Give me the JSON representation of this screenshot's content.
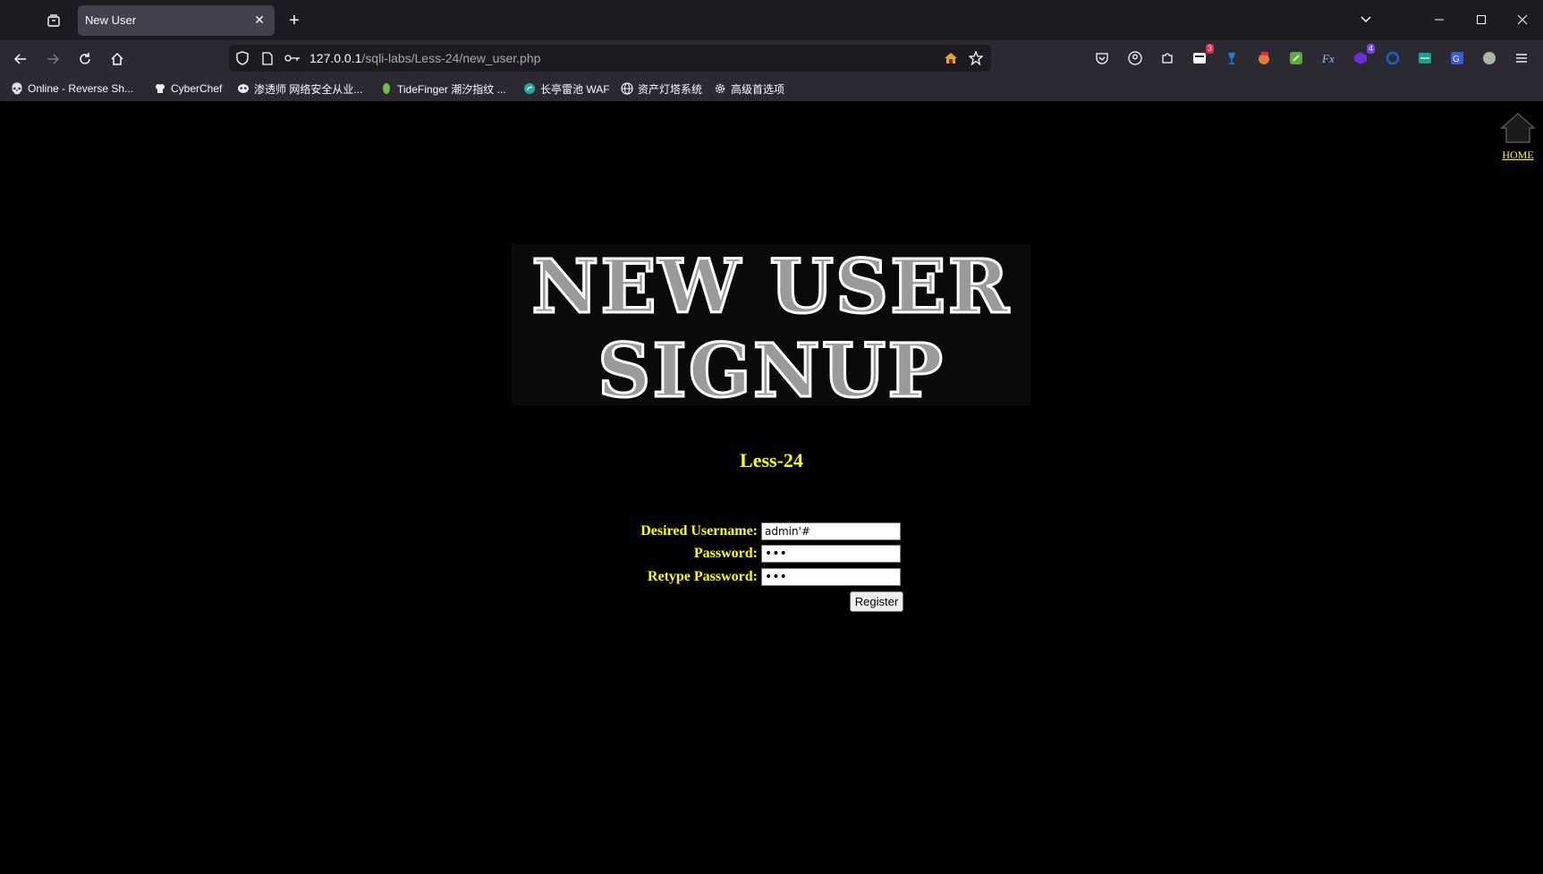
{
  "browser": {
    "tab_title": "New User",
    "url_host": "127.0.0.1",
    "url_path": "/sqli-labs/Less-24/new_user.php",
    "extension_badges": [
      "3",
      "4"
    ],
    "bookmarks": [
      {
        "label": "Online - Reverse Sh...",
        "icon": "skull-icon"
      },
      {
        "label": "CyberChef",
        "icon": "chef-hat-icon"
      },
      {
        "label": "渗透师 网络安全从业...",
        "icon": "mask-icon"
      },
      {
        "label": "TideFinger 潮汐指纹 ...",
        "icon": "tide-icon"
      },
      {
        "label": "长亭雷池 WAF",
        "icon": "shield-icon"
      },
      {
        "label": "资产灯塔系统",
        "icon": "globe-icon"
      },
      {
        "label": "高级首选项",
        "icon": "gear-icon"
      }
    ]
  },
  "page": {
    "home_label": "HOME",
    "banner_line1": "NEW USER",
    "banner_line2": "SIGNUP",
    "lesson_title": "Less-24",
    "form": {
      "username_label": "Desired Username:",
      "username_value": "admin'#",
      "password_label": "Password:",
      "password_value": "•••",
      "retype_label": "Retype Password:",
      "retype_value": "•••",
      "register_label": "Register"
    }
  },
  "colors": {
    "page_background": "#000000",
    "label_yellow": "#ffff00"
  }
}
